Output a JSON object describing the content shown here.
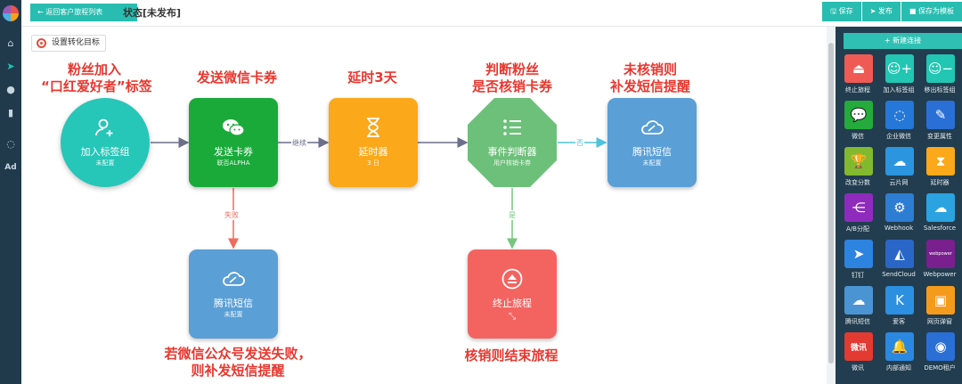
{
  "topbar": {
    "back_label": "← 返回客户旅程列表",
    "title": "状态[未发布]",
    "actions": [
      "🖫 保存",
      "➤ 发布",
      "■ 保存为模板"
    ]
  },
  "canvas": {
    "target_button": "设置转化目标",
    "annotations": {
      "a1_line1": "粉丝加入",
      "a1_line2": "“口红爱好者”标签",
      "a2": "发送微信卡券",
      "a3": "延时3天",
      "a4_line1": "判断粉丝",
      "a4_line2": "是否核销卡券",
      "a5_line1": "未核销则",
      "a5_line2": "补发短信提醒",
      "a6_line1": "若微信公众号发送失败，",
      "a6_line2": "则补发短信提醒",
      "a7": "核销则结束旅程"
    },
    "nodes": {
      "add_tag": {
        "title": "加入标签组",
        "sub": "未配置",
        "color": "#26c6b8"
      },
      "send_coupon": {
        "title": "发送卡券",
        "sub": "联否ALPHA",
        "color": "#1aaa3a"
      },
      "delay": {
        "title": "延时器",
        "sub": "3 日",
        "color": "#fba81a"
      },
      "judge": {
        "title": "事件判断器",
        "sub": "用户核销卡券",
        "color": "#6dc07a"
      },
      "sms_top": {
        "title": "腾讯短信",
        "sub": "未配置",
        "color": "#5a9fd6"
      },
      "sms_bottom": {
        "title": "腾讯短信",
        "sub": "未配置",
        "color": "#5a9fd6"
      },
      "end": {
        "title": "终止旅程",
        "sub": "",
        "color": "#f36460"
      }
    },
    "edge_labels": {
      "continue": "继续",
      "no": "否",
      "fail": "失败",
      "yes": "是"
    }
  },
  "palette": {
    "new_connection": "+ 新建连接",
    "tools": [
      {
        "label": "终止旅程",
        "color": "#f05a55",
        "icon": "eject-icon"
      },
      {
        "label": "加入标签组",
        "color": "#22c6b3",
        "icon": "user-plus-icon"
      },
      {
        "label": "移出标签组",
        "color": "#22c6b3",
        "icon": "user-minus-icon"
      },
      {
        "label": "微信",
        "color": "#24ab3b",
        "icon": "wechat-icon"
      },
      {
        "label": "企业微信",
        "color": "#2577d8",
        "icon": "work-wechat-icon"
      },
      {
        "label": "变更属性",
        "color": "#2a6fd6",
        "icon": "edit-icon"
      },
      {
        "label": "改变分数",
        "color": "#82b92f",
        "icon": "trophy-icon"
      },
      {
        "label": "云片网",
        "color": "#2b95e0",
        "icon": "cloud-icon"
      },
      {
        "label": "延时器",
        "color": "#fba81a",
        "icon": "hourglass-icon"
      },
      {
        "label": "A/B分配",
        "color": "#8e2bbd",
        "icon": "ab-split-icon"
      },
      {
        "label": "Webhook",
        "color": "#2d7dd2",
        "icon": "webhook-icon"
      },
      {
        "label": "Salesforce",
        "color": "#2aa3e0",
        "icon": "salesforce-icon"
      },
      {
        "label": "钉钉",
        "color": "#2c83e0",
        "icon": "dingtalk-icon"
      },
      {
        "label": "SendCloud",
        "color": "#2a66c7",
        "icon": "sendcloud-icon"
      },
      {
        "label": "Webpower",
        "color": "#7a1f8e",
        "icon": "webpower-icon"
      },
      {
        "label": "腾讯短信",
        "color": "#4b94d4",
        "icon": "cloud-icon"
      },
      {
        "label": "爱客",
        "color": "#2d8fe0",
        "icon": "aike-icon"
      },
      {
        "label": "网页弹窗",
        "color": "#f59b1c",
        "icon": "popup-icon"
      },
      {
        "label": "微讯",
        "color": "#e33a32",
        "icon": "weixun-icon"
      },
      {
        "label": "内部通知",
        "color": "#2b88e0",
        "icon": "bell-icon"
      },
      {
        "label": "DEMO租户",
        "color": "#2a6fd6",
        "icon": "demo-logo-icon"
      }
    ],
    "tool_text": {
      "weixun": "微讯",
      "webpower": "webpower"
    }
  }
}
